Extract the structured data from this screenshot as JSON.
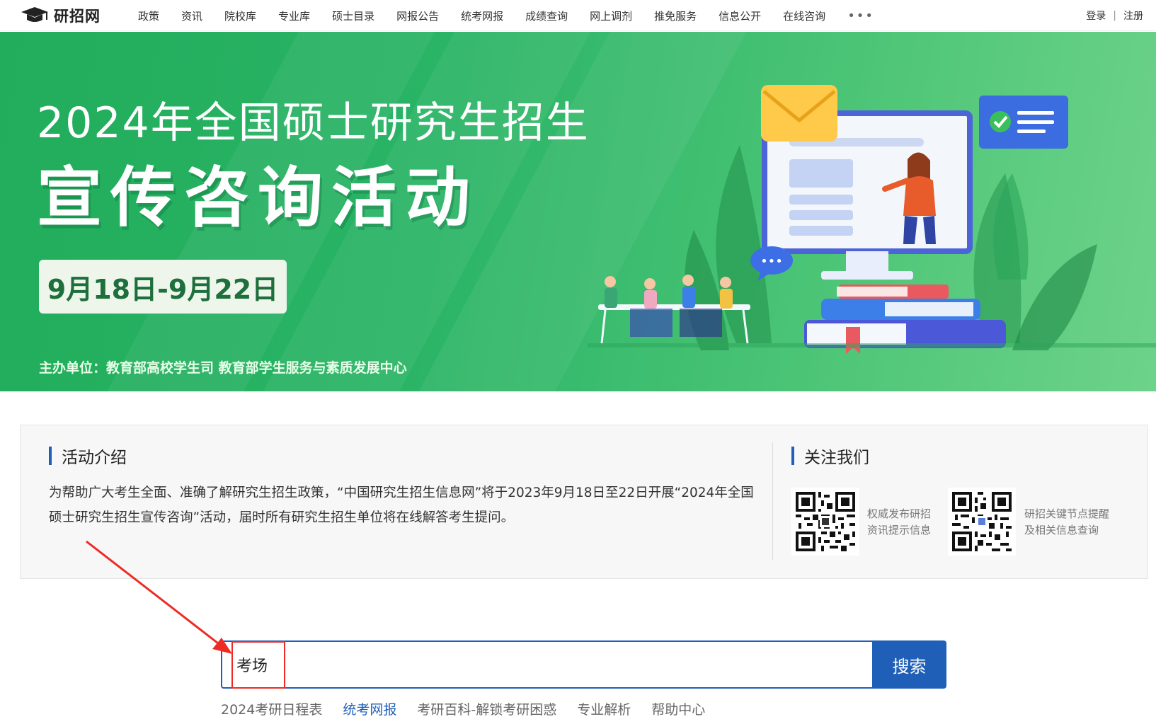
{
  "header": {
    "logo_text": "研招网",
    "nav": [
      "政策",
      "资讯",
      "院校库",
      "专业库",
      "硕士目录",
      "网报公告",
      "统考网报",
      "成绩查询",
      "网上调剂",
      "推免服务",
      "信息公开",
      "在线咨询"
    ],
    "more": "•••",
    "login": "登录",
    "separator": "|",
    "register": "注册"
  },
  "banner": {
    "subtitle": "2024年全国硕士研究生招生",
    "title": "宣传咨询活动",
    "dates": "9月18日-9月22日",
    "organizer": "主办单位：教育部高校学生司  教育部学生服务与素质发展中心",
    "bubble": "•••"
  },
  "intro": {
    "heading": "活动介绍",
    "text": "为帮助广大考生全面、准确了解研究生招生政策，“中国研究生招生信息网”将于2023年9月18日至22日开展“2024年全国硕士研究生招生宣传咨询”活动，届时所有研究生招生单位将在线解答考生提问。"
  },
  "follow": {
    "heading": "关注我们",
    "qr1_line1": "权威发布研招",
    "qr1_line2": "资讯提示信息",
    "qr2_line1": "研招关键节点提醒",
    "qr2_line2": "及相关信息查询"
  },
  "search": {
    "value": "考场",
    "button": "搜索"
  },
  "quick_links": [
    "2024考研日程表",
    "统考网报",
    "考研百科-解锁考研困惑",
    "专业解析",
    "帮助中心"
  ],
  "colors": {
    "brand_blue": "#1f5fb8",
    "banner_green": "#2ab466",
    "annotation_red": "#ee2a24"
  },
  "icons": {
    "logo": "graduation-cap-icon",
    "mail": "envelope-icon",
    "check": "checkmark-icon"
  }
}
